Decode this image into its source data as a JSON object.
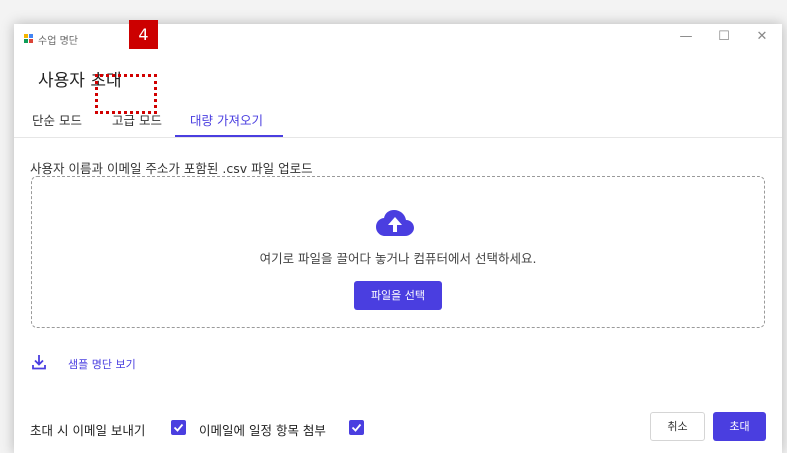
{
  "window": {
    "title": "수업 명단",
    "controls": {
      "minimize": "—",
      "maximize": "☐",
      "close": "✕"
    }
  },
  "dialog": {
    "title": "사용자 초대",
    "step_badge": "4"
  },
  "tabs": [
    {
      "label": "단순 모드",
      "active": false
    },
    {
      "label": "고급 모드",
      "active": false
    },
    {
      "label": "대량 가져오기",
      "active": true
    }
  ],
  "upload": {
    "label": "사용자 이름과 이메일 주소가 포함된 .csv 파일 업로드",
    "drop_text": "여기로 파일을 끌어다 놓거나 컴퓨터에서 선택하세요.",
    "choose_button": "파일을 선택",
    "icon": "cloud-upload-icon"
  },
  "sample": {
    "link": "샘플 명단 보기",
    "icon": "download-icon"
  },
  "options": {
    "send_email": {
      "label": "초대 시 이메일 보내기",
      "checked": true
    },
    "attach_schedule": {
      "label": "이메일에 일정 항목 첨부",
      "checked": true
    }
  },
  "buttons": {
    "cancel": "취소",
    "invite": "초대"
  },
  "colors": {
    "accent": "#4a3ee0",
    "highlight": "#cc0000"
  }
}
